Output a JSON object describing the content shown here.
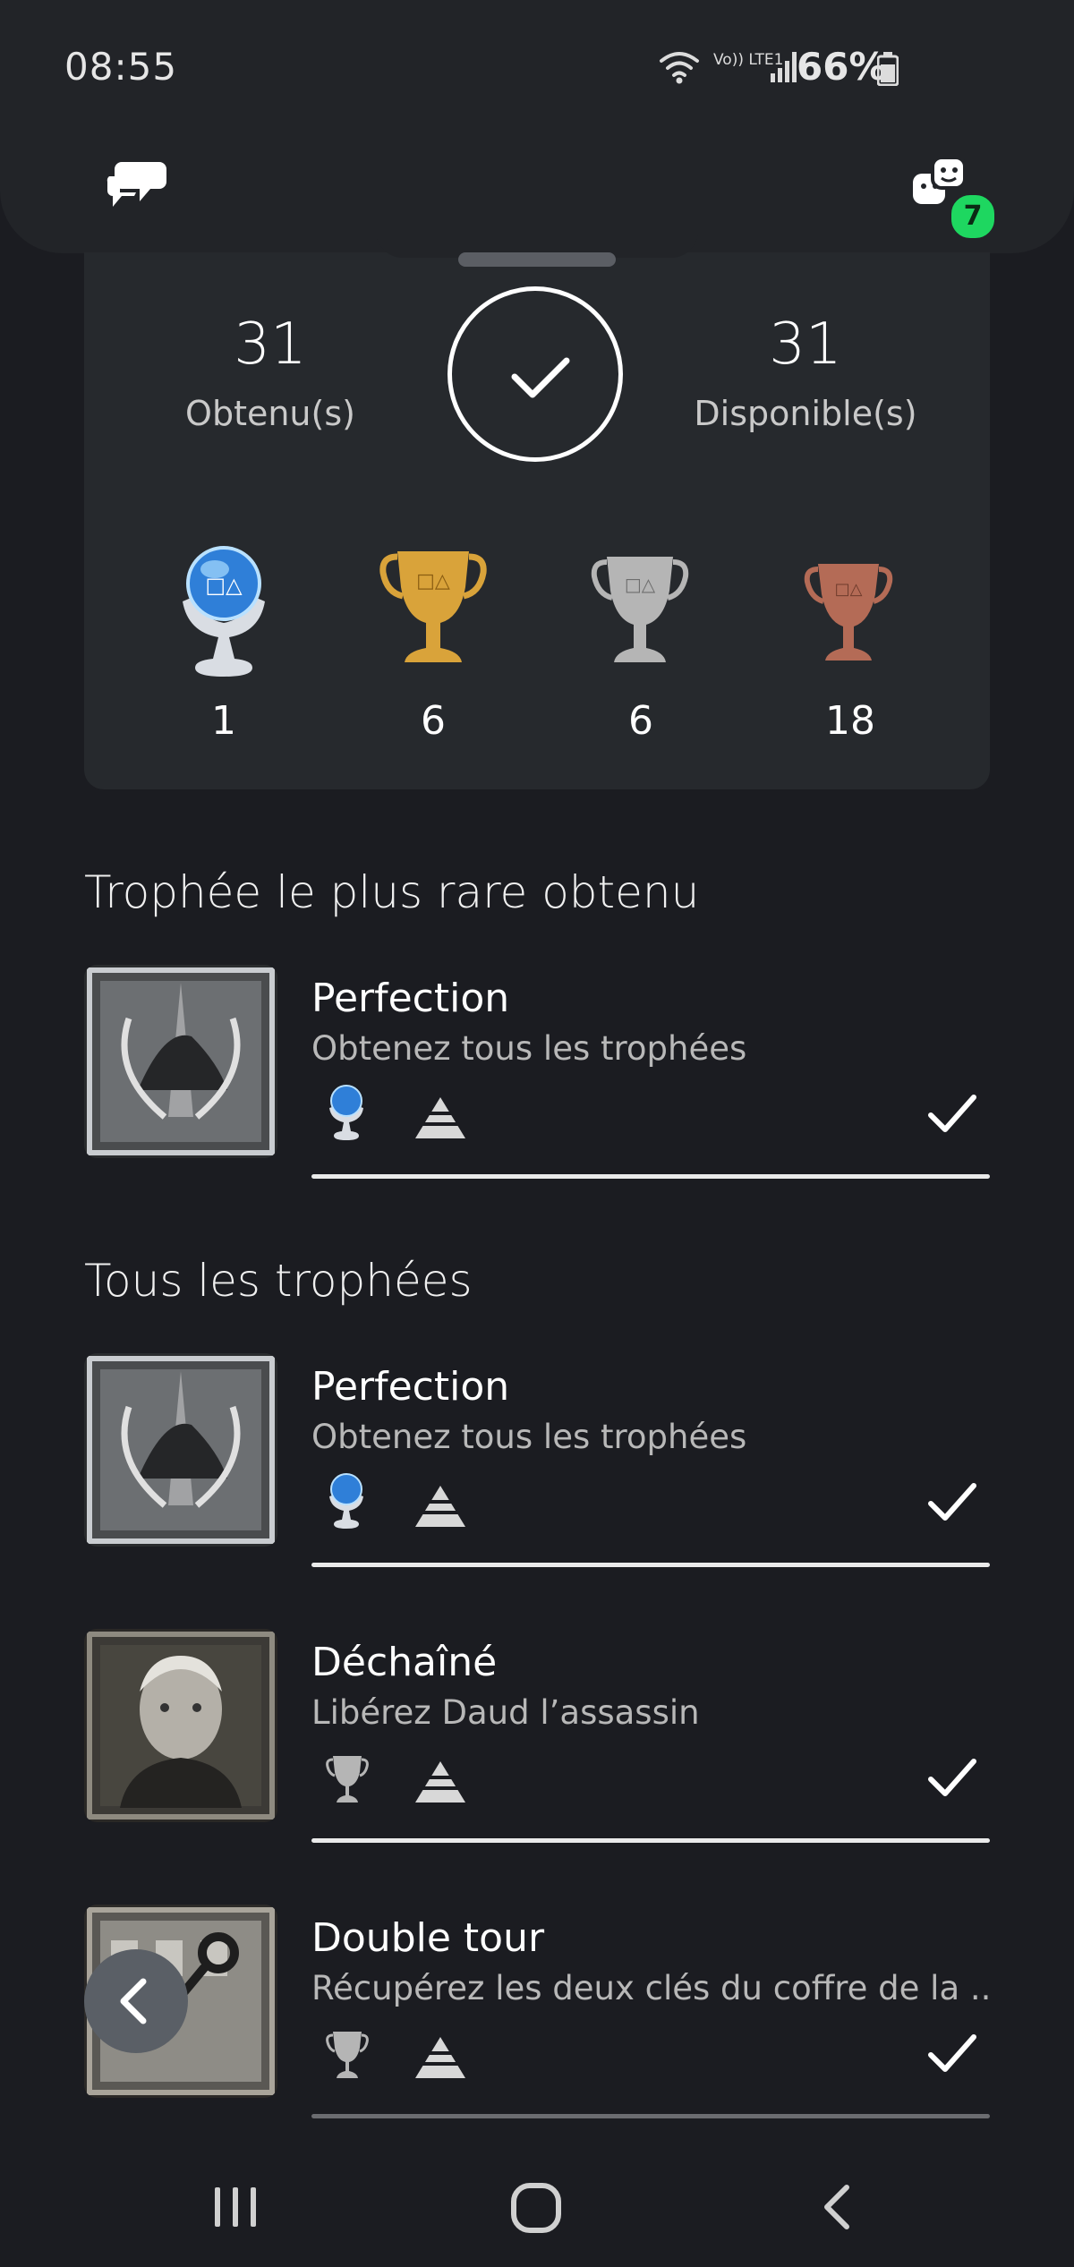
{
  "status_bar": {
    "time": "08:55",
    "network": "Vo)) LTE1",
    "battery": "66%"
  },
  "header": {
    "left_icon": "chat-bubbles-icon",
    "right_icon": "friends-icon",
    "friends_badge": "7"
  },
  "summary": {
    "earned_value": "31",
    "earned_label": "Obtenu(s)",
    "available_value": "31",
    "available_label": "Disponible(s)",
    "trophies": [
      {
        "type": "platinum",
        "count": "1",
        "color": "#7ec6f0"
      },
      {
        "type": "gold",
        "count": "6",
        "color": "#d9a33a"
      },
      {
        "type": "silver",
        "count": "6",
        "color": "#b5b5b5"
      },
      {
        "type": "bronze",
        "count": "18",
        "color": "#b46b56"
      }
    ]
  },
  "rarest": {
    "title": "Trophée le plus rare obtenu",
    "item": {
      "name": "Perfection",
      "description": "Obtenez tous les trophées",
      "trophy": "platinum"
    }
  },
  "all": {
    "title": "Tous les trophées",
    "items": [
      {
        "name": "Perfection",
        "description": "Obtenez tous les trophées",
        "trophy": "platinum"
      },
      {
        "name": "Déchaîné",
        "description": "Libérez Daud l’assassin",
        "trophy": "silver"
      },
      {
        "name": "Double tour",
        "description": "Récupérez les deux clés du coffre de la ...",
        "trophy": "silver"
      }
    ]
  }
}
